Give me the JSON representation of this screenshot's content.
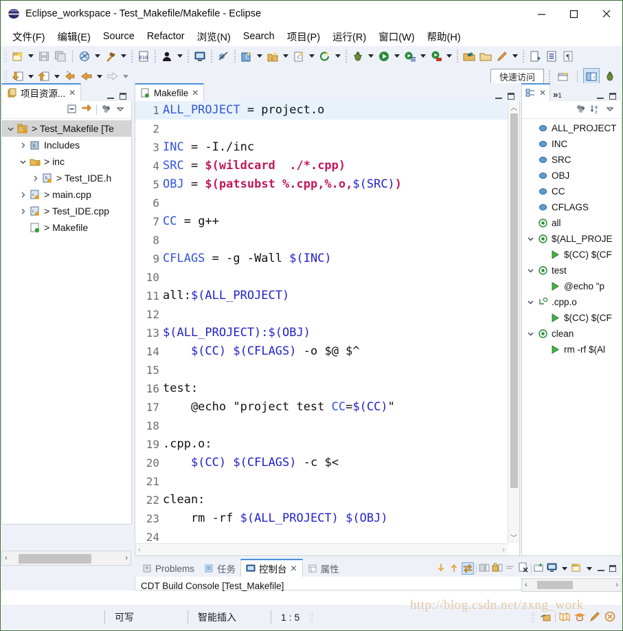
{
  "window": {
    "title": "Eclipse_workspace - Test_Makefile/Makefile - Eclipse",
    "app_icon": "eclipse-icon",
    "minimize": "minimize-icon",
    "maximize": "maximize-icon",
    "close": "close-icon"
  },
  "menubar": {
    "items": [
      {
        "label": "文件(F)",
        "mnemonic": "F"
      },
      {
        "label": "编辑(E)",
        "mnemonic": "E"
      },
      {
        "label": "Source",
        "mnemonic": "S"
      },
      {
        "label": "Refactor",
        "mnemonic": "c"
      },
      {
        "label": "浏览(N)",
        "mnemonic": "N"
      },
      {
        "label": "Search",
        "mnemonic": "a"
      },
      {
        "label": "项目(P)",
        "mnemonic": "P"
      },
      {
        "label": "运行(R)",
        "mnemonic": "R"
      },
      {
        "label": "窗口(W)",
        "mnemonic": "W"
      },
      {
        "label": "帮助(H)",
        "mnemonic": "H"
      }
    ]
  },
  "toolbar": {
    "quick_access_label": "快速访问",
    "icons_row1": [
      "new-file-icon",
      "save-icon",
      "save-all-icon",
      "build-all-icon",
      "build-hammer-icon",
      "binary-icon",
      "user-icon",
      "console-icon",
      "skip-breakpoints-icon",
      "new-c-project-icon",
      "new-cpp-class-icon",
      "new-c-file-icon",
      "refresh-icon",
      "debug-bug-icon",
      "run-icon",
      "run-config-icon",
      "run-external-icon",
      "open-folder-icon",
      "open-type-icon",
      "pencil-icon",
      "open-task-icon",
      "toggle-block-icon",
      "pilcrow-icon"
    ],
    "icons_row2": [
      "next-annotation-icon",
      "previous-annotation-icon",
      "last-edit-icon",
      "back-icon",
      "forward-icon"
    ],
    "perspective_icons": [
      "open-perspective-icon",
      "cpp-perspective-icon",
      "debug-perspective-icon"
    ]
  },
  "project_explorer": {
    "tab_label": "项目资源...",
    "tab_icon": "project-explorer-icon",
    "toolbar_icons": [
      "collapse-all-icon",
      "link-with-editor-icon",
      "filter-icon",
      "view-menu-icon"
    ],
    "tree": [
      {
        "label": "> Test_Makefile [Te",
        "icon": "cpp-project-icon",
        "twist": "down",
        "depth": 0,
        "selected": true
      },
      {
        "label": "Includes",
        "icon": "includes-icon",
        "twist": "right",
        "depth": 1,
        "selected": false
      },
      {
        "label": "> inc",
        "icon": "source-folder-icon",
        "twist": "down",
        "depth": 1,
        "selected": false
      },
      {
        "label": "> Test_IDE.h",
        "icon": "header-file-icon",
        "twist": "right",
        "depth": 2,
        "selected": false
      },
      {
        "label": "> main.cpp",
        "icon": "cpp-file-icon",
        "twist": "right",
        "depth": 1,
        "selected": false
      },
      {
        "label": "> Test_IDE.cpp",
        "icon": "cpp-file-icon",
        "twist": "right",
        "depth": 1,
        "selected": false
      },
      {
        "label": "> Makefile",
        "icon": "makefile-icon",
        "twist": "none",
        "depth": 1,
        "selected": false
      }
    ]
  },
  "editor": {
    "tab_label": "Makefile",
    "tab_icon": "makefile-icon",
    "lines": [
      {
        "n": "1",
        "highlight": true,
        "tokens": [
          {
            "t": "ALL_PROJECT",
            "c": "var"
          },
          {
            "t": " = project.o",
            "c": "plain"
          }
        ]
      },
      {
        "n": "2",
        "highlight": false,
        "tokens": []
      },
      {
        "n": "3",
        "highlight": false,
        "tokens": [
          {
            "t": "INC",
            "c": "var"
          },
          {
            "t": " = -I./inc",
            "c": "plain"
          }
        ]
      },
      {
        "n": "4",
        "highlight": false,
        "tokens": [
          {
            "t": "SRC",
            "c": "var"
          },
          {
            "t": " = ",
            "c": "plain"
          },
          {
            "t": "$(wildcard  ./*.cpp)",
            "c": "fn"
          }
        ]
      },
      {
        "n": "5",
        "highlight": false,
        "tokens": [
          {
            "t": "OBJ",
            "c": "var"
          },
          {
            "t": " = ",
            "c": "plain"
          },
          {
            "t": "$(patsubst %.cpp,%.o,",
            "c": "fn"
          },
          {
            "t": "$(SRC)",
            "c": "blue"
          },
          {
            "t": ")",
            "c": "fn"
          }
        ]
      },
      {
        "n": "6",
        "highlight": false,
        "tokens": []
      },
      {
        "n": "7",
        "highlight": false,
        "tokens": [
          {
            "t": "CC",
            "c": "var"
          },
          {
            "t": " = g++",
            "c": "plain"
          }
        ]
      },
      {
        "n": "8",
        "highlight": false,
        "tokens": []
      },
      {
        "n": "9",
        "highlight": false,
        "tokens": [
          {
            "t": "CFLAGS",
            "c": "var"
          },
          {
            "t": " = -g -Wall ",
            "c": "plain"
          },
          {
            "t": "$(INC)",
            "c": "blue"
          }
        ]
      },
      {
        "n": "10",
        "highlight": false,
        "tokens": []
      },
      {
        "n": "11",
        "highlight": false,
        "tokens": [
          {
            "t": "all:",
            "c": "plain"
          },
          {
            "t": "$(ALL_PROJECT)",
            "c": "blue"
          }
        ]
      },
      {
        "n": "12",
        "highlight": false,
        "tokens": []
      },
      {
        "n": "13",
        "highlight": false,
        "tokens": [
          {
            "t": "$(ALL_PROJECT)",
            "c": "blue"
          },
          {
            "t": ":",
            "c": "blue"
          },
          {
            "t": "$(OBJ)",
            "c": "blue"
          }
        ]
      },
      {
        "n": "14",
        "highlight": false,
        "tokens": [
          {
            "t": "    ",
            "c": "plain"
          },
          {
            "t": "$(CC)",
            "c": "blue"
          },
          {
            "t": " ",
            "c": "plain"
          },
          {
            "t": "$(CFLAGS)",
            "c": "blue"
          },
          {
            "t": " -o $@ $^",
            "c": "plain"
          }
        ]
      },
      {
        "n": "15",
        "highlight": false,
        "tokens": []
      },
      {
        "n": "16",
        "highlight": false,
        "tokens": [
          {
            "t": "test:",
            "c": "plain"
          }
        ]
      },
      {
        "n": "17",
        "highlight": false,
        "tokens": [
          {
            "t": "    @echo \"project test ",
            "c": "plain"
          },
          {
            "t": "CC",
            "c": "var"
          },
          {
            "t": "=",
            "c": "plain"
          },
          {
            "t": "$(CC)",
            "c": "blue"
          },
          {
            "t": "\"",
            "c": "plain"
          }
        ]
      },
      {
        "n": "18",
        "highlight": false,
        "tokens": []
      },
      {
        "n": "19",
        "highlight": false,
        "tokens": [
          {
            "t": ".cpp.o:",
            "c": "plain"
          }
        ]
      },
      {
        "n": "20",
        "highlight": false,
        "tokens": [
          {
            "t": "    ",
            "c": "plain"
          },
          {
            "t": "$(CC)",
            "c": "blue"
          },
          {
            "t": " ",
            "c": "plain"
          },
          {
            "t": "$(CFLAGS)",
            "c": "blue"
          },
          {
            "t": " -c $<",
            "c": "plain"
          }
        ]
      },
      {
        "n": "21",
        "highlight": false,
        "tokens": []
      },
      {
        "n": "22",
        "highlight": false,
        "tokens": [
          {
            "t": "clean:",
            "c": "plain"
          }
        ]
      },
      {
        "n": "23",
        "highlight": false,
        "tokens": [
          {
            "t": "    rm -rf ",
            "c": "plain"
          },
          {
            "t": "$(ALL_PROJECT)",
            "c": "blue"
          },
          {
            "t": " ",
            "c": "plain"
          },
          {
            "t": "$(OBJ)",
            "c": "blue"
          }
        ]
      },
      {
        "n": "24",
        "highlight": false,
        "tokens": []
      }
    ]
  },
  "outline": {
    "tab_icon": "outline-icon",
    "overflow_label": "»",
    "overflow_count": "1",
    "toolbar_icons": [
      "hide-icon",
      "sort-az-icon",
      "view-menu-icon"
    ],
    "items": [
      {
        "label": "ALL_PROJECT",
        "icon": "macro-icon",
        "twist": "none",
        "depth": 0
      },
      {
        "label": "INC",
        "icon": "macro-icon",
        "twist": "none",
        "depth": 0
      },
      {
        "label": "SRC",
        "icon": "macro-icon",
        "twist": "none",
        "depth": 0
      },
      {
        "label": "OBJ",
        "icon": "macro-icon",
        "twist": "none",
        "depth": 0
      },
      {
        "label": "CC",
        "icon": "macro-icon",
        "twist": "none",
        "depth": 0
      },
      {
        "label": "CFLAGS",
        "icon": "macro-icon",
        "twist": "none",
        "depth": 0
      },
      {
        "label": "all",
        "icon": "target-icon",
        "twist": "none",
        "depth": 0
      },
      {
        "label": "$(ALL_PROJE",
        "icon": "target-icon",
        "twist": "down",
        "depth": 0
      },
      {
        "label": "$(CC) $(CF",
        "icon": "command-icon",
        "twist": "none",
        "depth": 1
      },
      {
        "label": "test",
        "icon": "target-icon",
        "twist": "down",
        "depth": 0
      },
      {
        "label": "@echo \"p",
        "icon": "command-icon",
        "twist": "none",
        "depth": 1
      },
      {
        "label": ".cpp.o",
        "icon": "rule-icon",
        "twist": "down",
        "depth": 0
      },
      {
        "label": "$(CC) $(CF",
        "icon": "command-icon",
        "twist": "none",
        "depth": 1
      },
      {
        "label": "clean",
        "icon": "target-icon",
        "twist": "down",
        "depth": 0
      },
      {
        "label": "rm -rf $(Al",
        "icon": "command-icon",
        "twist": "none",
        "depth": 1
      }
    ]
  },
  "console_panel": {
    "tabs": [
      {
        "label": "Problems",
        "icon": "problems-icon",
        "active": false
      },
      {
        "label": "任务",
        "icon": "tasks-icon",
        "active": false
      },
      {
        "label": "控制台",
        "icon": "console-icon",
        "active": true
      },
      {
        "label": "属性",
        "icon": "properties-icon",
        "active": false
      }
    ],
    "toolbar_icons": [
      "scroll-down-icon",
      "scroll-up-icon",
      "scroll-lock-icon",
      "save-console-icon",
      "lock-console-icon",
      "wrap-icon",
      "clear-console-icon",
      "pin-console-icon",
      "display-console-icon",
      "display-console-arrow",
      "open-console-icon",
      "open-console-arrow",
      "minimize-icon",
      "maximize-icon"
    ],
    "content": "CDT Build Console [Test_Makefile]"
  },
  "statusbar": {
    "writable": "可写",
    "insert_mode": "智能插入",
    "position": "1 : 5",
    "watermark": "http://blog.csdn.net/zxng_work",
    "right_icons": [
      "lock-icon",
      "map-icon",
      "graduation-icon",
      "pencil-icon",
      "cdt-icon"
    ]
  },
  "colors": {
    "accent": "#4a90d9",
    "toolbar_bg": "#eef1f8",
    "code_var": "#3355dd",
    "code_fn": "#c2185b",
    "selection": "#d4d4d4",
    "line_highlight": "#e8f2fb"
  }
}
